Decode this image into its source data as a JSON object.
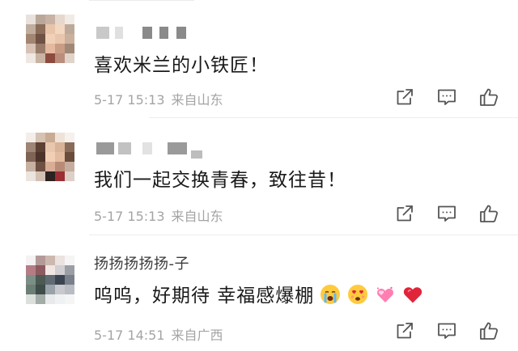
{
  "comments": [
    {
      "username": "",
      "text": "喜欢米兰的小铁匠！",
      "date": "5-17 15:13",
      "location": "来自山东"
    },
    {
      "username": "",
      "text": "我们一起交换青春，致往昔！",
      "date": "5-17 15:13",
      "location": "来自山东"
    },
    {
      "username": "扬扬扬扬扬-子",
      "text": "呜呜，好期待 幸福感爆棚",
      "date": "5-17 14:51",
      "location": "来自广西"
    }
  ],
  "icons": {
    "share": "share-icon",
    "reply": "comment-icon",
    "like": "thumbs-up-icon",
    "emoji_1": "crying-face-emoji",
    "emoji_2": "heart-eyes-face-emoji",
    "emoji_3": "hearts-emoji",
    "emoji_4": "red-heart-emoji"
  },
  "colors": {
    "text": "#1a1a1a",
    "meta": "#a4a4a4",
    "icon": "#555555",
    "heart": "#e0243a"
  }
}
